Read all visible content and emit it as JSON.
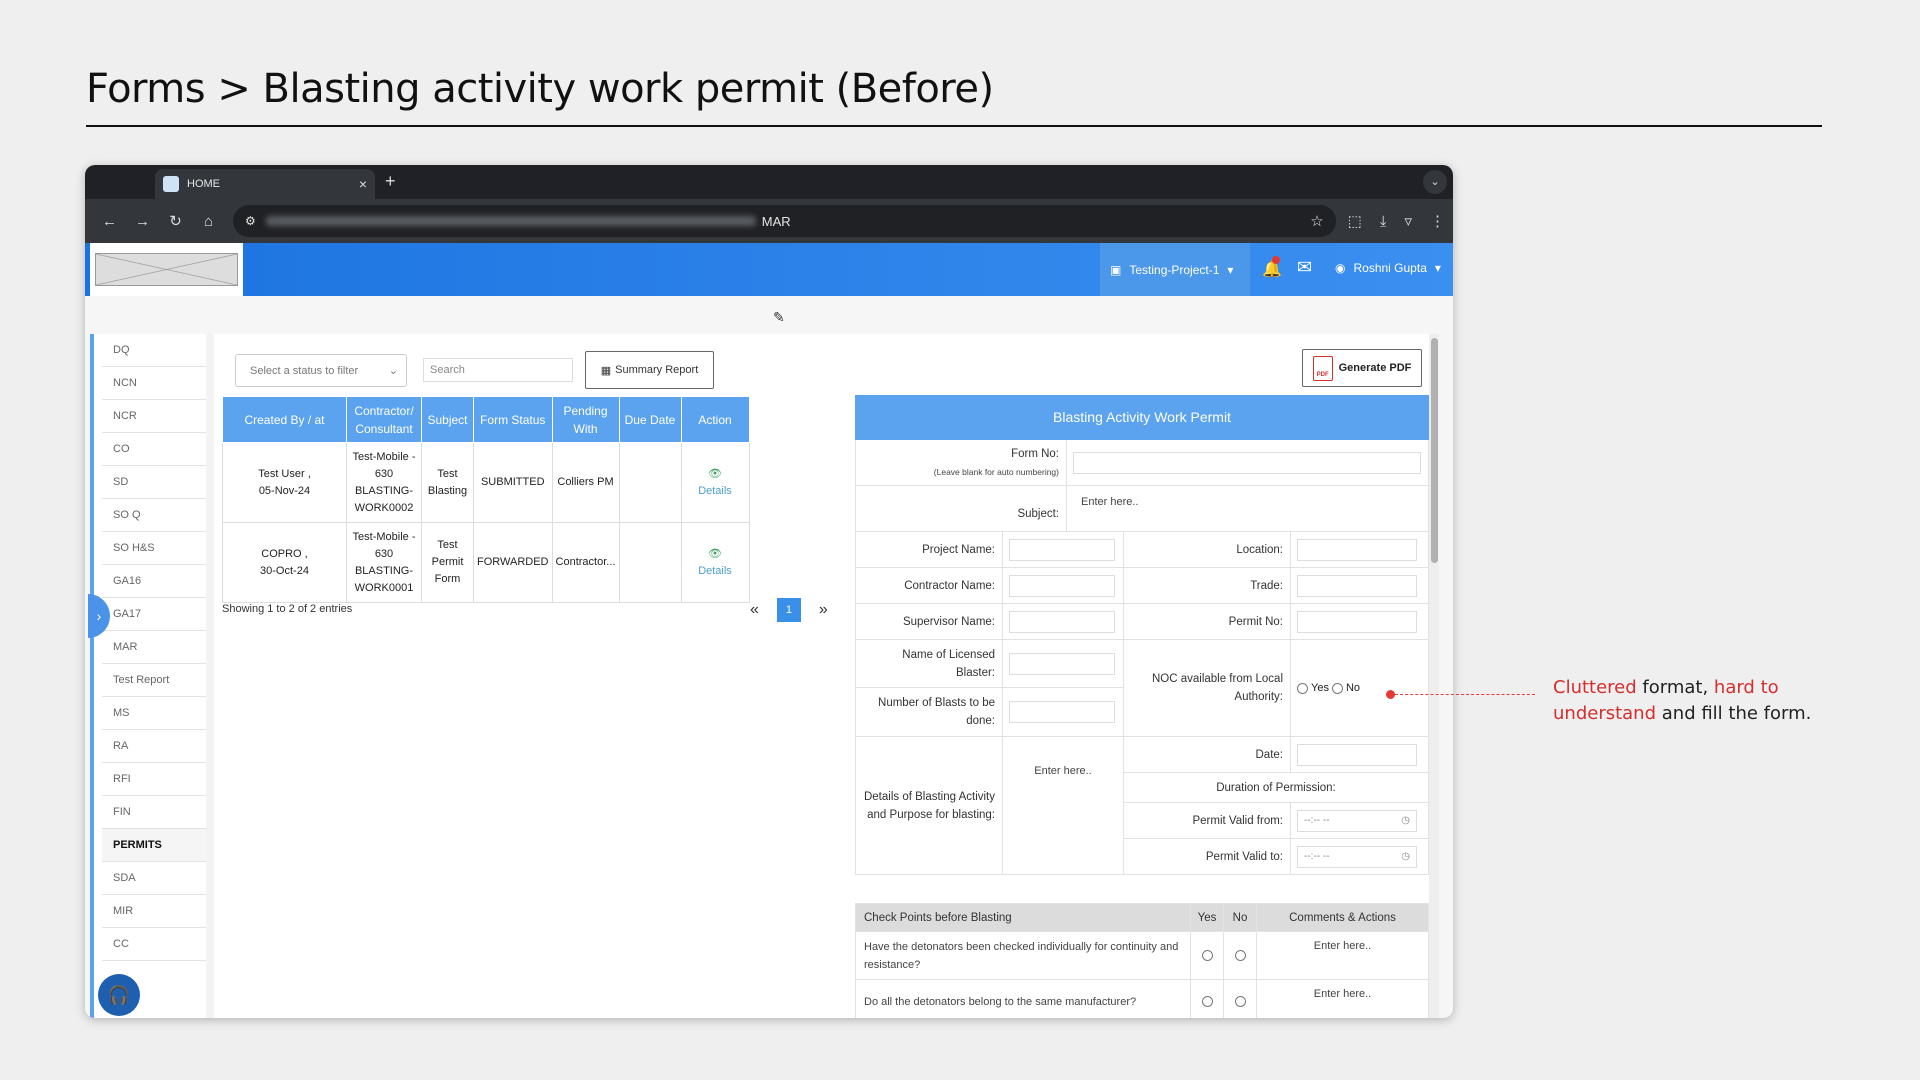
{
  "slide": {
    "title": "Forms > Blasting activity work permit (Before)"
  },
  "browser": {
    "tab_title": "HOME",
    "tab_close": "×",
    "new_tab": "+",
    "tab_menu": "⌄",
    "url_tail": "MAR",
    "nav": {
      "back": "←",
      "forward": "→",
      "reload": "↻",
      "home": "⌂"
    },
    "icons": {
      "tune": "⚙",
      "star": "☆",
      "extensions": "⬚",
      "download": "⤓",
      "profile": "▿",
      "menu": "⋮"
    }
  },
  "header": {
    "project": "Testing-Project-1",
    "project_icon": "▣",
    "caret": "▾",
    "bell": "🔔",
    "mail": "✉",
    "user_icon": "◉",
    "user": "Roshni Gupta"
  },
  "edit_icon": "✎",
  "sidebar": {
    "items": [
      "DQ",
      "NCN",
      "NCR",
      "CO",
      "SD",
      "SO Q",
      "SO H&S",
      "GA16",
      "GA17",
      "MAR",
      "Test Report",
      "MS",
      "RA",
      "RFI",
      "FIN",
      "PERMITS",
      "SDA",
      "MIR",
      "CC"
    ],
    "toggle": "›",
    "support_icon": "🎧"
  },
  "toolbar": {
    "filter_placeholder": "Select a status to filter",
    "filter_caret": "⌄",
    "search_placeholder": "Search",
    "summary_icon": "▦",
    "summary_label": "Summary Report",
    "pdf_icon": "PDF",
    "pdf_label": "Generate PDF"
  },
  "table": {
    "headers": [
      "Created By / at",
      "Contractor/ Consultant",
      "Subject",
      "Form Status",
      "Pending With",
      "Due Date",
      "Action"
    ],
    "rows": [
      {
        "created": "Test User , 05-Nov-24",
        "contractor": "Test-Mobile - 630 BLASTING-WORK0002",
        "subject": "Test Blasting",
        "status": "SUBMITTED",
        "pending": "Colliers PM",
        "due": "",
        "action_icon": "👁",
        "action": "Details"
      },
      {
        "created": "COPRO , 30-Oct-24",
        "contractor": "Test-Mobile - 630 BLASTING-WORK0001",
        "subject": "Test Permit Form",
        "status": "FORWARDED",
        "pending": "Contractor...",
        "due": "",
        "action_icon": "👁",
        "action": "Details"
      }
    ],
    "showing": "Showing 1 to 2 of 2 entries",
    "pager": {
      "prev": "«",
      "page": "1",
      "next": "»"
    }
  },
  "form": {
    "title": "Blasting Activity Work Permit",
    "form_no": "Form No:",
    "form_no_hint": "(Leave blank for auto numbering)",
    "subject": "Subject:",
    "enter_here": "Enter here..",
    "project_name": "Project Name:",
    "location": "Location:",
    "contractor_name": "Contractor Name:",
    "trade": "Trade:",
    "supervisor_name": "Supervisor Name:",
    "permit_no": "Permit No:",
    "licensed_blaster": "Name of Licensed Blaster:",
    "noc": "NOC available from Local Authority:",
    "yes": "Yes",
    "no": "No",
    "num_blasts": "Number of Blasts to be done:",
    "details": "Details of Blasting Activity and Purpose for blasting:",
    "date": "Date:",
    "duration": "Duration of Permission:",
    "valid_from": "Permit Valid from:",
    "valid_to": "Permit Valid to:",
    "time_placeholder": "--:-- --",
    "clock_icon": "◷"
  },
  "checks": {
    "headers": [
      "Check Points before Blasting",
      "Yes",
      "No",
      "Comments & Actions"
    ],
    "rows": [
      {
        "q": "Have the detonators been checked individually for continuity and resistance?",
        "comment": "Enter here.."
      },
      {
        "q": "Do all the detonators belong to the same manufacturer?",
        "comment": "Enter here.."
      }
    ]
  },
  "annotation": {
    "part1": "Cluttered",
    "part2": " format, ",
    "part3": "hard to understand",
    "part4": " and fill the form.",
    "accent": "#d32f2f"
  }
}
